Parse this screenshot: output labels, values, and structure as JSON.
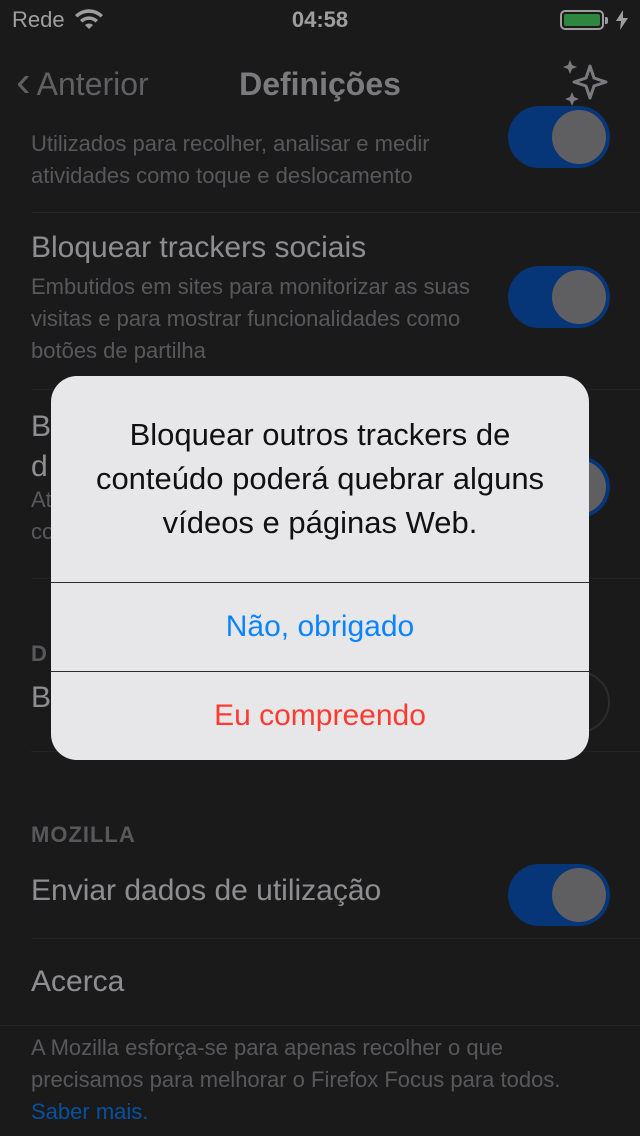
{
  "status_bar": {
    "carrier": "Rede",
    "time": "04:58",
    "battery_percent": 100,
    "battery_color": "#4cd964"
  },
  "nav": {
    "back_label": "Anterior",
    "title": "Definições",
    "icon": "sparkle-icon"
  },
  "rows": [
    {
      "subtitle": "Utilizados para recolher, analisar e medir atividades como toque e deslocamento",
      "toggle_on": true
    },
    {
      "title": "Bloquear trackers sociais",
      "subtitle": "Embutidos em sites para monitorizar as suas visitas e para mostrar funcionalidades como botões de partilha",
      "toggle_on": true
    },
    {
      "title_partial": "B",
      "title_partial2": "d",
      "subtitle_partial": "At",
      "subtitle_partial2": "co",
      "toggle_on": true
    }
  ],
  "section2": {
    "header_partial": "D",
    "row_title_partial": "B",
    "toggle_on": false
  },
  "mozilla": {
    "header": "MOZILLA",
    "send_usage_label": "Enviar dados de utilização",
    "send_usage_on": true,
    "about_label": "Acerca",
    "footer_text": "A Mozilla esforça-se para apenas recolher o que precisamos para melhorar o Firefox Focus para todos.",
    "footer_link": "Saber mais."
  },
  "alert": {
    "message": "Bloquear outros trackers de conteúdo poderá quebrar alguns vídeos e páginas Web.",
    "cancel_label": "Não, obrigado",
    "confirm_label": "Eu compreendo"
  },
  "colors": {
    "accent": "#0a84ff",
    "destructive": "#ff3b30",
    "toggle_on": "#0a56c2"
  }
}
